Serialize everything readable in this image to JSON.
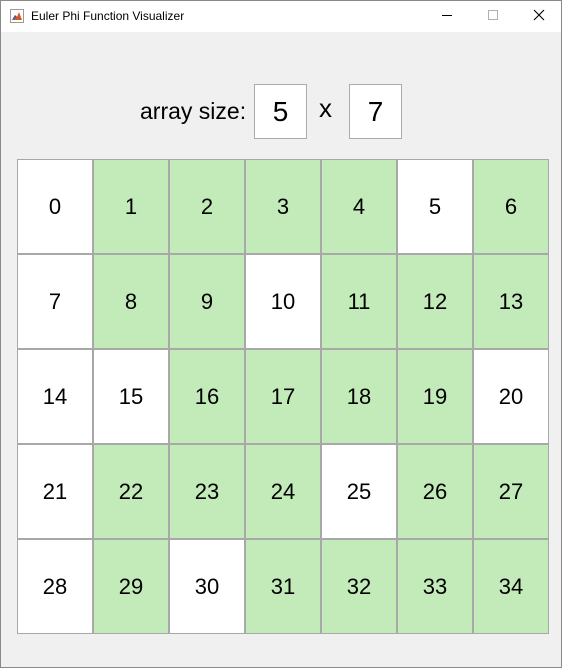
{
  "window": {
    "title": "Euler Phi Function Visualizer",
    "icons": {
      "app": "matlab-icon",
      "minimize": "minimize-icon",
      "maximize": "maximize-icon",
      "close": "close-icon"
    }
  },
  "controls": {
    "array_size_label": "array size:",
    "rows": "5",
    "separator": "x",
    "cols": "7"
  },
  "colors": {
    "coprime": "#c3eab9",
    "not_coprime": "#ffffff"
  },
  "grid": {
    "rows": 5,
    "cols": 7,
    "cells": [
      {
        "value": "0",
        "highlighted": false
      },
      {
        "value": "1",
        "highlighted": true
      },
      {
        "value": "2",
        "highlighted": true
      },
      {
        "value": "3",
        "highlighted": true
      },
      {
        "value": "4",
        "highlighted": true
      },
      {
        "value": "5",
        "highlighted": false
      },
      {
        "value": "6",
        "highlighted": true
      },
      {
        "value": "7",
        "highlighted": false
      },
      {
        "value": "8",
        "highlighted": true
      },
      {
        "value": "9",
        "highlighted": true
      },
      {
        "value": "10",
        "highlighted": false
      },
      {
        "value": "11",
        "highlighted": true
      },
      {
        "value": "12",
        "highlighted": true
      },
      {
        "value": "13",
        "highlighted": true
      },
      {
        "value": "14",
        "highlighted": false
      },
      {
        "value": "15",
        "highlighted": false
      },
      {
        "value": "16",
        "highlighted": true
      },
      {
        "value": "17",
        "highlighted": true
      },
      {
        "value": "18",
        "highlighted": true
      },
      {
        "value": "19",
        "highlighted": true
      },
      {
        "value": "20",
        "highlighted": false
      },
      {
        "value": "21",
        "highlighted": false
      },
      {
        "value": "22",
        "highlighted": true
      },
      {
        "value": "23",
        "highlighted": true
      },
      {
        "value": "24",
        "highlighted": true
      },
      {
        "value": "25",
        "highlighted": false
      },
      {
        "value": "26",
        "highlighted": true
      },
      {
        "value": "27",
        "highlighted": true
      },
      {
        "value": "28",
        "highlighted": false
      },
      {
        "value": "29",
        "highlighted": true
      },
      {
        "value": "30",
        "highlighted": false
      },
      {
        "value": "31",
        "highlighted": true
      },
      {
        "value": "32",
        "highlighted": true
      },
      {
        "value": "33",
        "highlighted": true
      },
      {
        "value": "34",
        "highlighted": true
      }
    ]
  }
}
